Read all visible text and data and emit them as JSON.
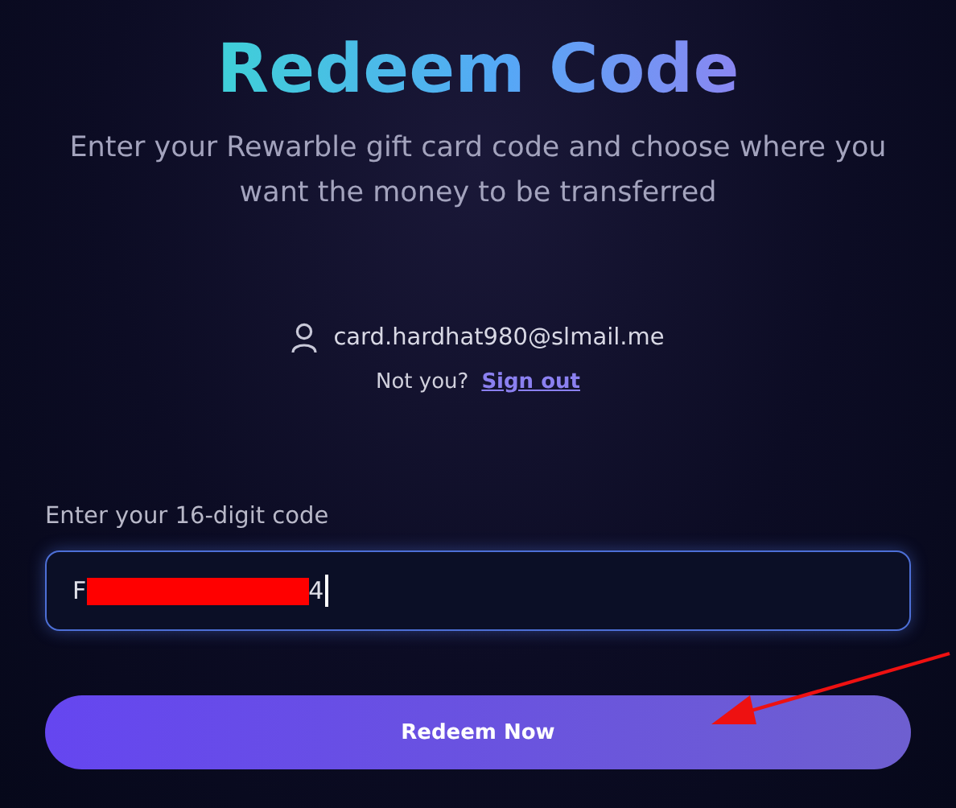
{
  "title": "Redeem Code",
  "subtitle": "Enter your Rewarble gift card code and choose where you want the money to be transferred",
  "account": {
    "email": "card.hardhat980@slmail.me",
    "prompt": "Not you?",
    "sign_out": "Sign out"
  },
  "code_field": {
    "label": "Enter your 16-digit code",
    "value_start": "F",
    "redacted": true,
    "value_end": "4",
    "focused": true
  },
  "submit_button": "Redeem Now",
  "annotations": [
    {
      "kind": "arrow",
      "color": "#ee1111"
    }
  ]
}
